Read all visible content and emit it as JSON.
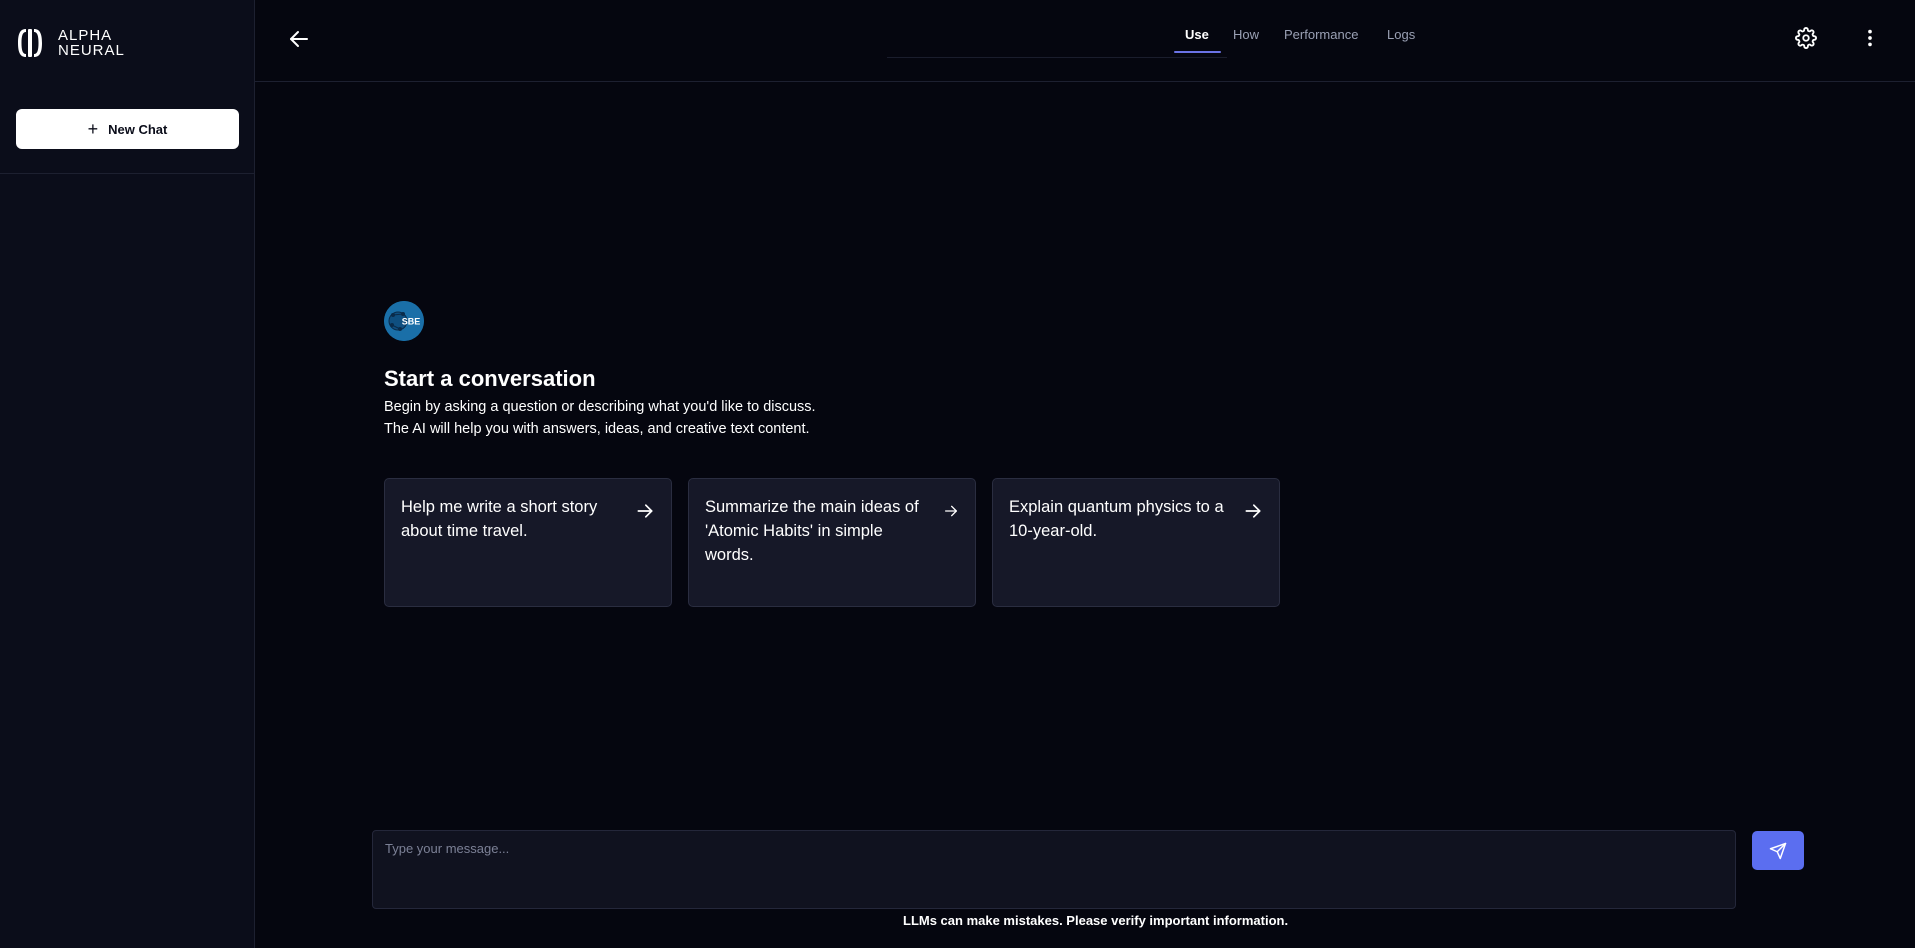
{
  "brand": {
    "line1": "ALPHA",
    "line2": "NEURAL"
  },
  "sidebar": {
    "new_chat_label": "New Chat",
    "new_chat_icon": "plus-icon"
  },
  "header": {
    "back_icon": "arrow-left-icon",
    "tabs": [
      {
        "label": "Use",
        "active": true
      },
      {
        "label": "How",
        "active": false
      },
      {
        "label": "Performance",
        "active": false
      },
      {
        "label": "Logs",
        "active": false
      }
    ],
    "settings_icon": "gear-icon",
    "more_icon": "more-vertical-icon"
  },
  "main": {
    "avatar_text": "SBE",
    "title": "Start a conversation",
    "description": "Begin by asking a question or describing what you'd like to discuss. The AI will help you with answers, ideas, and creative text content.",
    "suggestions": [
      {
        "text": "Help me write a short story about time travel."
      },
      {
        "text": "Summarize the main ideas of 'Atomic Habits' in simple words."
      },
      {
        "text": "Explain quantum physics to a 10-year-old."
      }
    ]
  },
  "composer": {
    "placeholder": "Type your message...",
    "send_icon": "send-icon",
    "disclaimer": "LLMs can make mistakes. Please verify important information."
  },
  "colors": {
    "background": "#05060f",
    "sidebar": "#0b0d1a",
    "card": "#161828",
    "accent": "#5b6ef0",
    "tab_underline": "#6b73e6"
  }
}
